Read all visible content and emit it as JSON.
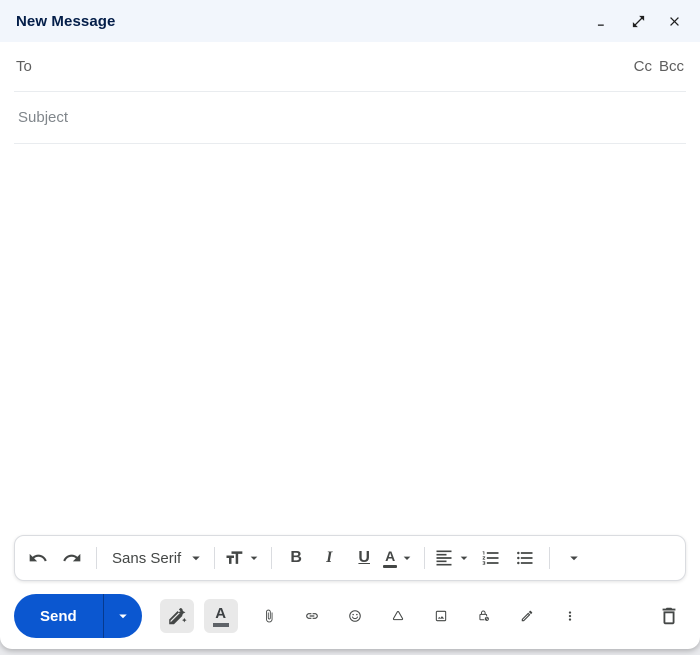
{
  "window": {
    "title": "New Message"
  },
  "header": {
    "icons": [
      "minimize-icon",
      "pop-out-icon",
      "close-icon"
    ]
  },
  "recipients": {
    "to_label": "To",
    "to_value": "",
    "cc_label": "Cc",
    "bcc_label": "Bcc"
  },
  "subject": {
    "placeholder": "Subject",
    "value": ""
  },
  "body": {
    "text": ""
  },
  "format_toolbar": {
    "font_name": "Sans Serif",
    "bold_label": "B",
    "italic_label": "I",
    "underline_label": "U",
    "text_color_label": "A",
    "icons": [
      "undo-icon",
      "redo-icon",
      "font-size-icon",
      "bold-icon",
      "italic-icon",
      "underline-icon",
      "text-color-icon",
      "align-icon",
      "numbered-list-icon",
      "bulleted-list-icon",
      "more-formatting-icon"
    ]
  },
  "bottom_toolbar": {
    "send_label": "Send",
    "text_color_label": "A",
    "icons": [
      "send-dropdown-icon",
      "help-me-write-icon",
      "formatting-options-icon",
      "attach-file-icon",
      "insert-link-icon",
      "insert-emoji-icon",
      "drive-icon",
      "insert-image-icon",
      "confidential-mode-icon",
      "signature-icon",
      "more-options-icon",
      "discard-draft-icon"
    ],
    "active_icons": [
      "help-me-write-icon",
      "formatting-options-icon"
    ]
  },
  "colors": {
    "header_bg": "#F2F6FC",
    "header_title": "#041E49",
    "accent_blue": "#0B57D0",
    "send_divider": "#063A8F",
    "icon_gray": "#444746",
    "muted_text": "#5E5E5E",
    "placeholder_text": "#80868B",
    "row_divider": "#E9ECEF",
    "toolbar_border": "#DADCE0",
    "active_button_bg": "#E9E9E9"
  }
}
